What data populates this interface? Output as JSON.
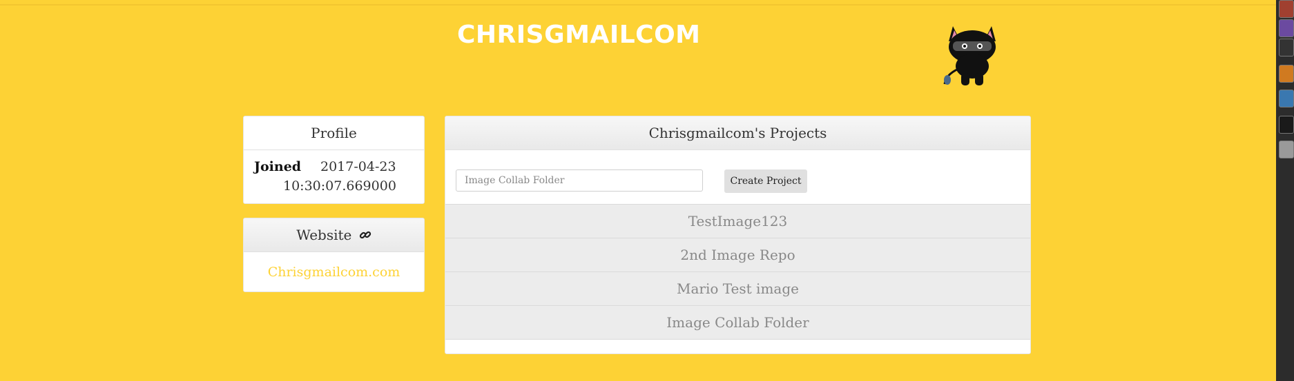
{
  "header": {
    "title": "CHRISGMAILCOM"
  },
  "profile": {
    "heading": "Profile",
    "joined_label": "Joined",
    "joined_date": "2017-04-23",
    "joined_time": "10:30:07.669000"
  },
  "website": {
    "heading": "Website",
    "link_text": "Chrisgmailcom.com",
    "icon": "link-icon"
  },
  "projects": {
    "heading": "Chrisgmailcom's Projects",
    "input_placeholder": "Image Collab Folder",
    "create_label": "Create Project",
    "items": [
      {
        "name": "TestImage123"
      },
      {
        "name": "2nd Image Repo"
      },
      {
        "name": "Mario Test image"
      },
      {
        "name": "Image Collab Folder"
      }
    ]
  },
  "colors": {
    "background": "#fdd235",
    "panel": "#ffffff",
    "link": "#fdd235",
    "project_row": "#ececec"
  }
}
